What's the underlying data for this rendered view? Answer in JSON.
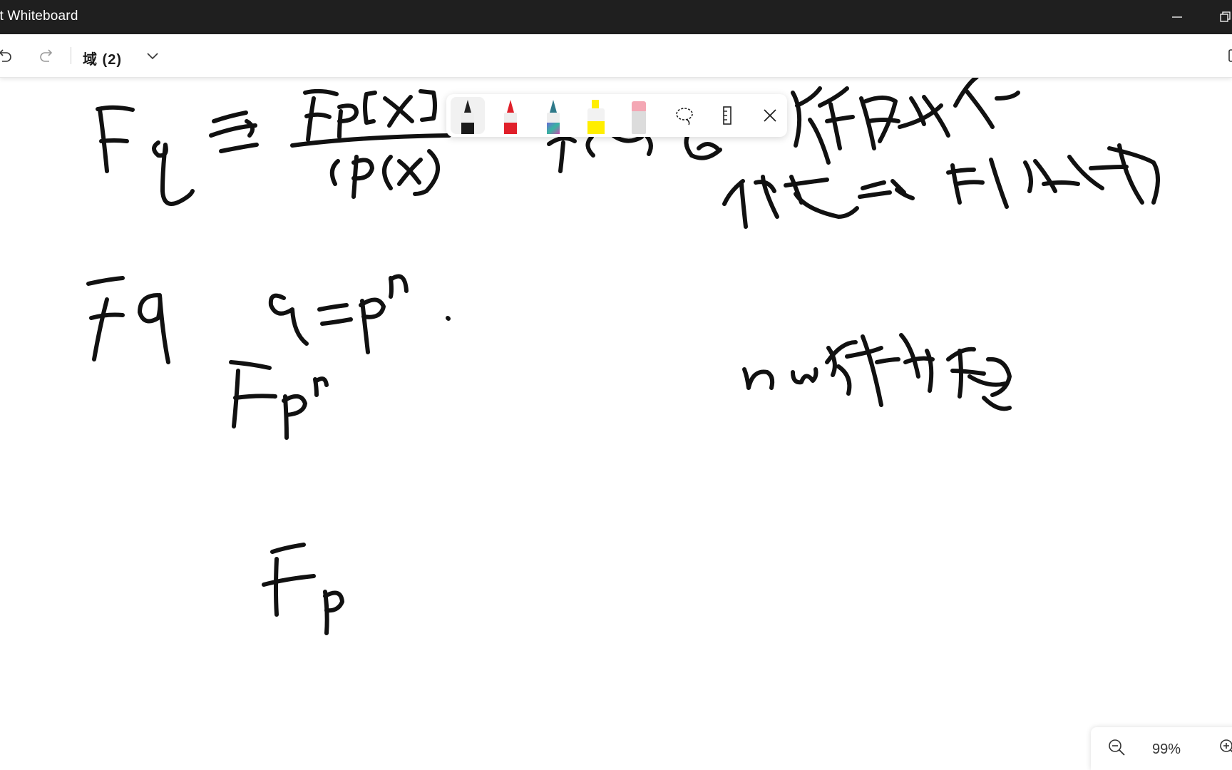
{
  "window": {
    "title": "ft Whiteboard"
  },
  "toolbar": {
    "board_title": "域 (2)"
  },
  "zoom": {
    "level": "99%"
  },
  "pen_tray": {
    "tools": [
      "black-pen",
      "red-pen",
      "galaxy-pen",
      "highlighter-yellow",
      "eraser",
      "lasso-select",
      "ruler",
      "close-tray"
    ]
  },
  "colors": {
    "titlebar": "#1f1f1f",
    "ink": "#111111",
    "accent_red": "#e0202a",
    "highlighter": "#ffee00"
  }
}
